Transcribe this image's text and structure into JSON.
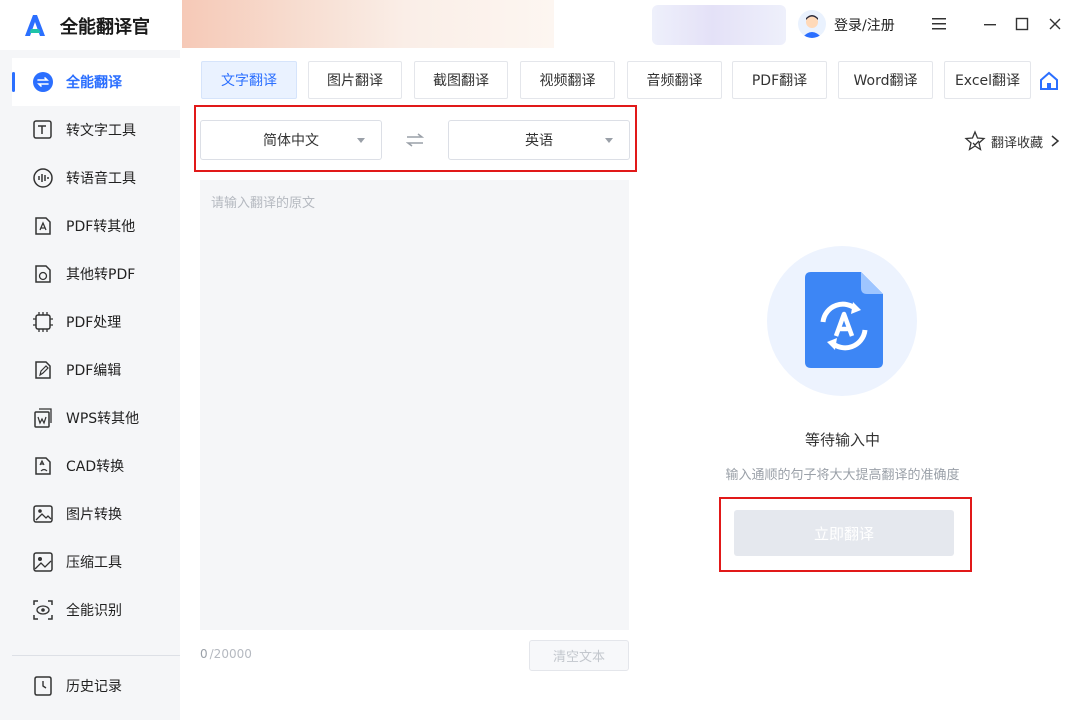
{
  "app": {
    "title": "全能翻译官",
    "login_label": "登录/注册"
  },
  "sidebar": {
    "items": [
      {
        "label": "全能翻译",
        "icon": "translate-icon",
        "active": true
      },
      {
        "label": "转文字工具",
        "icon": "text-tool-icon"
      },
      {
        "label": "转语音工具",
        "icon": "voice-tool-icon"
      },
      {
        "label": "PDF转其他",
        "icon": "pdf-convert-icon"
      },
      {
        "label": "其他转PDF",
        "icon": "to-pdf-icon"
      },
      {
        "label": "PDF处理",
        "icon": "pdf-process-icon"
      },
      {
        "label": "PDF编辑",
        "icon": "pdf-edit-icon"
      },
      {
        "label": "WPS转其他",
        "icon": "wps-convert-icon"
      },
      {
        "label": "CAD转换",
        "icon": "cad-convert-icon"
      },
      {
        "label": "图片转换",
        "icon": "image-convert-icon"
      },
      {
        "label": "压缩工具",
        "icon": "compress-icon"
      },
      {
        "label": "全能识别",
        "icon": "recognize-icon"
      },
      {
        "label": "历史记录",
        "icon": "history-icon"
      }
    ]
  },
  "tabs": [
    {
      "label": "文字翻译",
      "active": true
    },
    {
      "label": "图片翻译"
    },
    {
      "label": "截图翻译"
    },
    {
      "label": "视频翻译"
    },
    {
      "label": "音频翻译"
    },
    {
      "label": "PDF翻译"
    },
    {
      "label": "Word翻译"
    },
    {
      "label": "Excel翻译"
    }
  ],
  "language": {
    "source": "简体中文",
    "target": "英语"
  },
  "favorites_label": "翻译收藏",
  "input": {
    "placeholder": "请输入翻译的原文",
    "count": "0",
    "max": "/20000",
    "clear_label": "清空文本"
  },
  "output": {
    "status_title": "等待输入中",
    "status_hint": "输入通顺的句子将大大提高翻译的准确度",
    "translate_label": "立即翻译"
  },
  "colors": {
    "accent": "#2b6fff",
    "highlight_box": "#e11919"
  }
}
